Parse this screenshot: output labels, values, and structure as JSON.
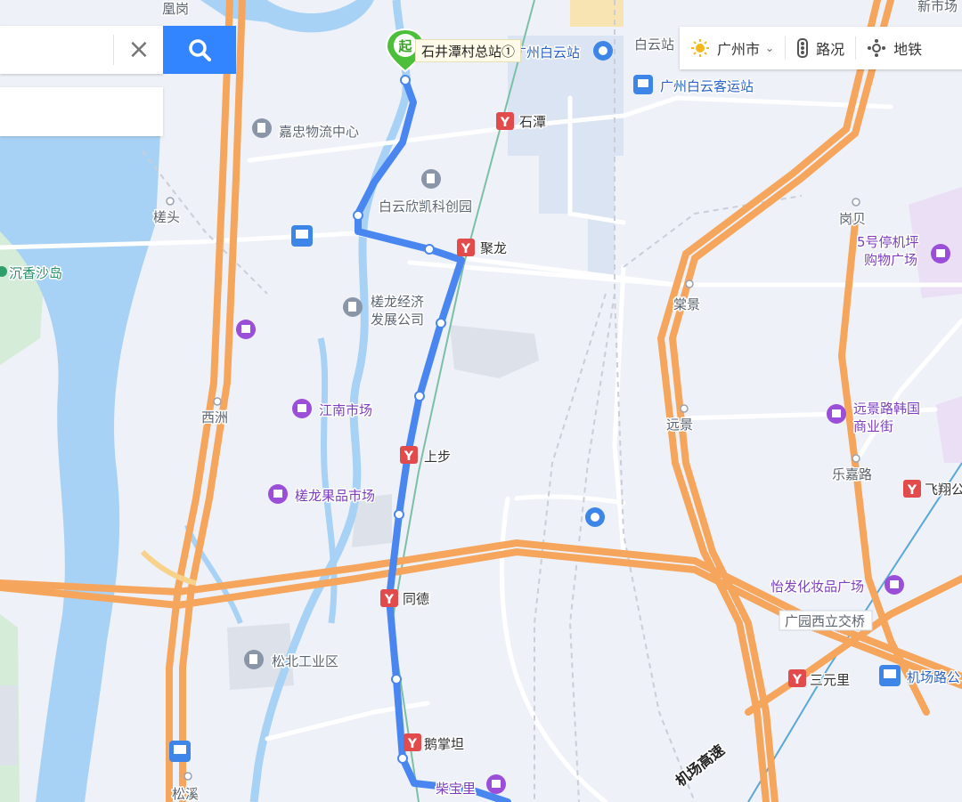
{
  "search": {
    "value": "",
    "placeholder": ""
  },
  "toolbar": {
    "city": "广州市",
    "traffic": "路况",
    "subway": "地铁"
  },
  "route": {
    "start_badge": "起",
    "start_label": "石井潭村总站①"
  },
  "labels": {
    "top_left_cut": "凰岗",
    "top_right_cut": "新市场",
    "baiyun_station": "广州白云站",
    "baiyun_short": "白云站",
    "baiyun_bus_station": "广州白云客运站",
    "shitan": "石潭",
    "jiazhong": "嘉忠物流中心",
    "xinkai": "白云欣凯科创园",
    "guitou": "槎头",
    "julong": "聚龙",
    "chenxiang": "沉香沙岛",
    "jingjifazhan": "槎龙经济发展公司",
    "gangbei": "岗贝",
    "parking_mall": "5号停机坪购物广场",
    "tangjing": "棠景",
    "xizhou": "西洲",
    "jiangnan_market": "江南市场",
    "yuanjing": "远景",
    "yuanjing_road": "远景路韩国商业街",
    "shangbu": "上步",
    "lejia_road": "乐嘉路",
    "feixiang": "飞翔公",
    "fruit_market": "槎龙果品市场",
    "tongde": "同德",
    "yifa": "怡发化妆品广场",
    "guangyuan_bridge": "广园西立交桥",
    "songbei": "松北工业区",
    "sanyuanli": "三元里",
    "airport_road": "机场路公",
    "ezhangtan": "鹅掌坦",
    "airport_expressway": "机场高速",
    "chaibao": "柴宝里",
    "songxi": "松溪"
  },
  "colors": {
    "route": "#4a86f0",
    "highway": "#f6a55c",
    "river": "#a8d2f5",
    "metro_icon": "#e24b4b",
    "shop_icon": "#9b4fd9",
    "start_marker": "#4cbf3a"
  }
}
